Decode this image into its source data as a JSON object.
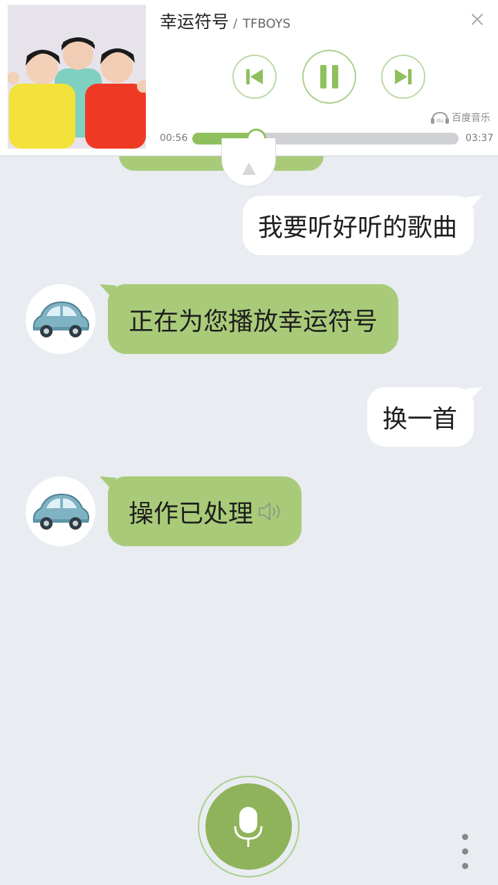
{
  "player": {
    "song_title": "幸运符号",
    "separator": "/",
    "artist": "TFBOYS",
    "current_time": "00:56",
    "total_time": "03:37",
    "progress": 0.24,
    "brand_badge": "du",
    "brand_label": "百度音乐",
    "icons": {
      "close": "close-icon",
      "previous": "skip-previous-icon",
      "pause": "pause-icon",
      "next": "skip-next-icon",
      "expand": "expand-up-icon"
    }
  },
  "chat": {
    "messages": [
      {
        "sender": "user",
        "text": "我要听好听的歌曲"
      },
      {
        "sender": "bot",
        "text": "正在为您播放幸运符号"
      },
      {
        "sender": "user",
        "text": "换一首"
      },
      {
        "sender": "bot",
        "text": "操作已处理",
        "icon": "speaker-icon"
      }
    ],
    "bot_avatar_icon": "car-icon"
  },
  "footer": {
    "mic_icon": "microphone-icon",
    "more_icon": "more-vertical-icon"
  },
  "colors": {
    "background": "#e9ecf1",
    "accent_green": "#8fc05d",
    "bot_bubble": "#a9cb79",
    "mic_button": "#8fb35a",
    "track_gray": "#cfd1d4"
  }
}
